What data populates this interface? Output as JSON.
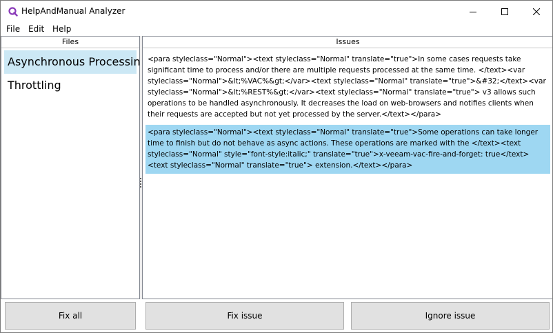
{
  "window": {
    "title": "HelpAndManual Analyzer",
    "accent": "#8a3ab9"
  },
  "menu": {
    "file": "File",
    "edit": "Edit",
    "help": "Help"
  },
  "files_panel": {
    "header": "Files",
    "items": [
      {
        "label": "Asynchronous Processing",
        "selected": true
      },
      {
        "label": "Throttling",
        "selected": false
      }
    ]
  },
  "issues_panel": {
    "header": "Issues",
    "items": [
      {
        "text": "<para styleclass=\"Normal\"><text styleclass=\"Normal\" translate=\"true\">In some cases requests take significant time to process and/or there are multiple requests processed at the same time. </text><var styleclass=\"Normal\">&lt;%VAC%&gt;</var><text styleclass=\"Normal\" translate=\"true\">&#32;</text><var styleclass=\"Normal\">&lt;%REST%&gt;</var><text styleclass=\"Normal\" translate=\"true\"> v3 allows such operations to be handled asynchronously. It decreases the load on web-browsers and notifies clients when their requests are accepted but not yet processed by the server.</text></para>",
        "selected": false
      },
      {
        "text": "<para styleclass=\"Normal\"><text styleclass=\"Normal\" translate=\"true\">Some operations can take longer time to finish but do not behave as async actions. These operations are marked with the </text><text styleclass=\"Normal\" style=\"font-style:italic;\" translate=\"true\">x-veeam-vac-fire-and-forget: true</text><text styleclass=\"Normal\" translate=\"true\"> extension.</text></para>",
        "selected": true
      }
    ]
  },
  "buttons": {
    "fix_all": "Fix all",
    "fix_issue": "Fix issue",
    "ignore_issue": "Ignore issue"
  },
  "colors": {
    "file_selected": "#cce8f5",
    "issue_selected": "#9ed7f2",
    "button_bg": "#e1e1e1"
  }
}
